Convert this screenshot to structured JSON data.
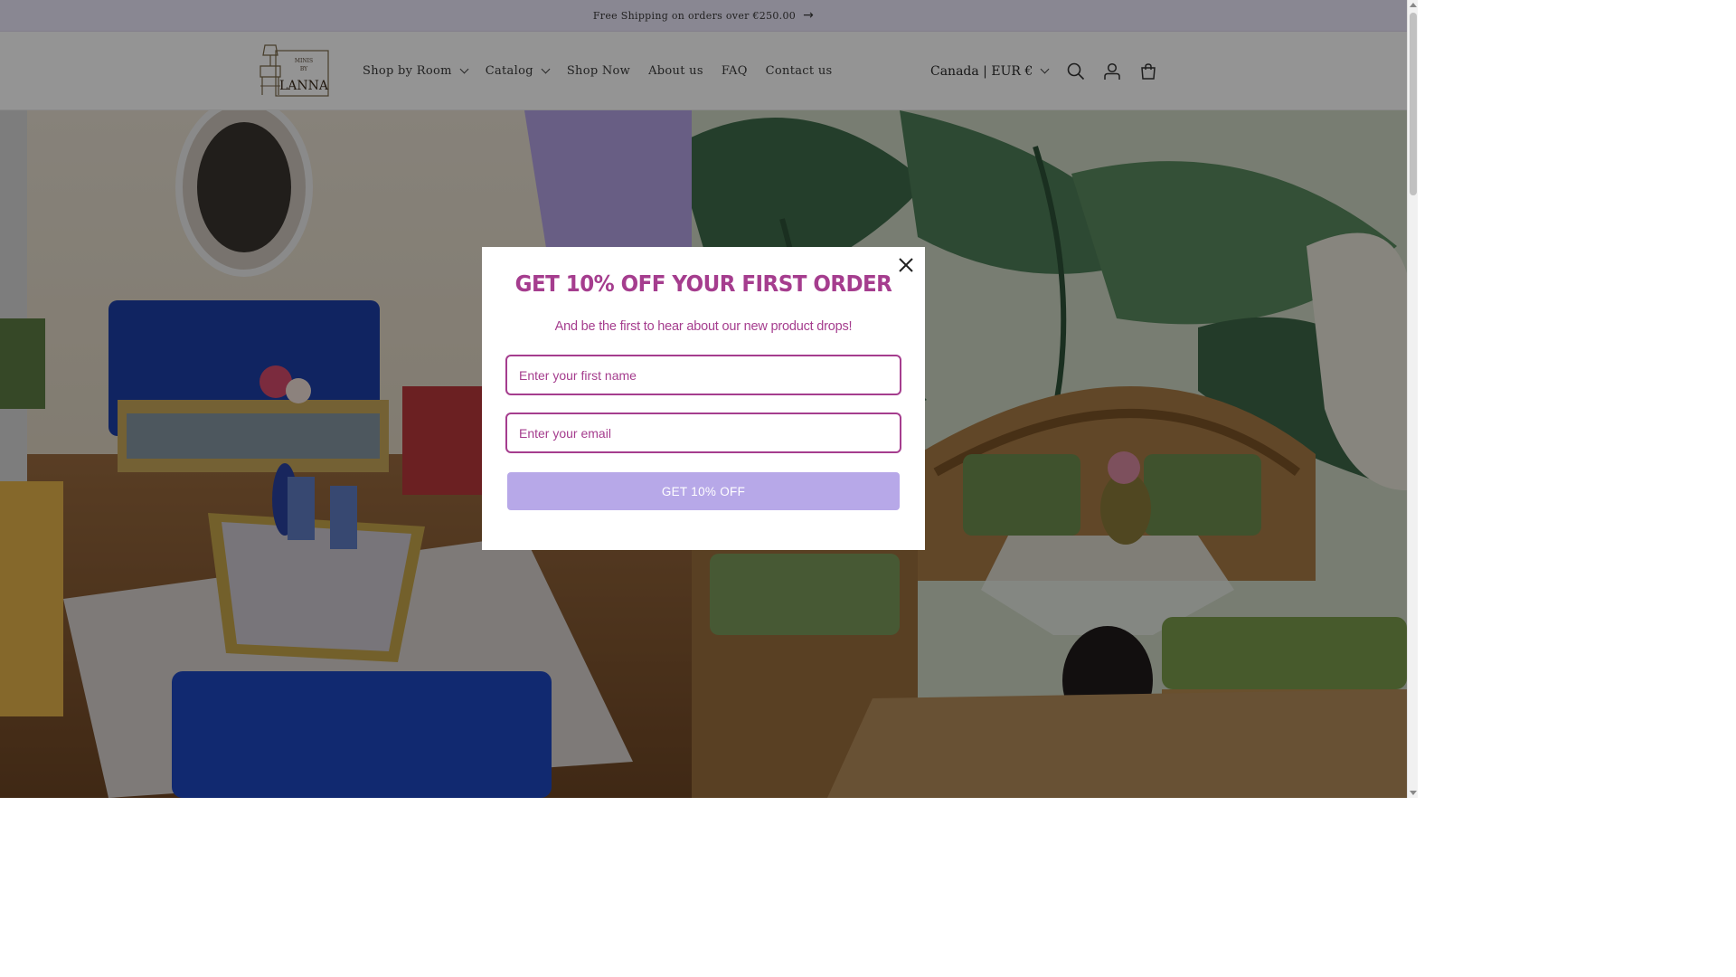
{
  "announcement": {
    "text": "Free Shipping on orders over €250.00",
    "arrow_icon": "arrow-right-icon"
  },
  "logo": {
    "lines": [
      "MINIS",
      "BY",
      "LANNA"
    ]
  },
  "nav": {
    "items": [
      {
        "label": "Shop by Room",
        "has_dropdown": true
      },
      {
        "label": "Catalog",
        "has_dropdown": true
      },
      {
        "label": "Shop Now",
        "has_dropdown": false
      },
      {
        "label": "About us",
        "has_dropdown": false
      },
      {
        "label": "FAQ",
        "has_dropdown": false
      },
      {
        "label": "Contact us",
        "has_dropdown": false
      }
    ]
  },
  "header": {
    "currency_label": "Canada | EUR €",
    "icons": [
      "search-icon",
      "account-icon",
      "cart-icon"
    ]
  },
  "popup": {
    "title": "GET 10% OFF YOUR FIRST ORDER",
    "subtitle": "And be the first to hear about our new product drops!",
    "first_name_placeholder": "Enter your first name",
    "email_placeholder": "Enter your email",
    "submit_label": "GET 10% OFF",
    "close_icon": "close-icon"
  },
  "colors": {
    "brand_pink": "#a53d8e",
    "button_lavender": "#b7a8e8",
    "announcement_bg": "#ede8fb"
  }
}
